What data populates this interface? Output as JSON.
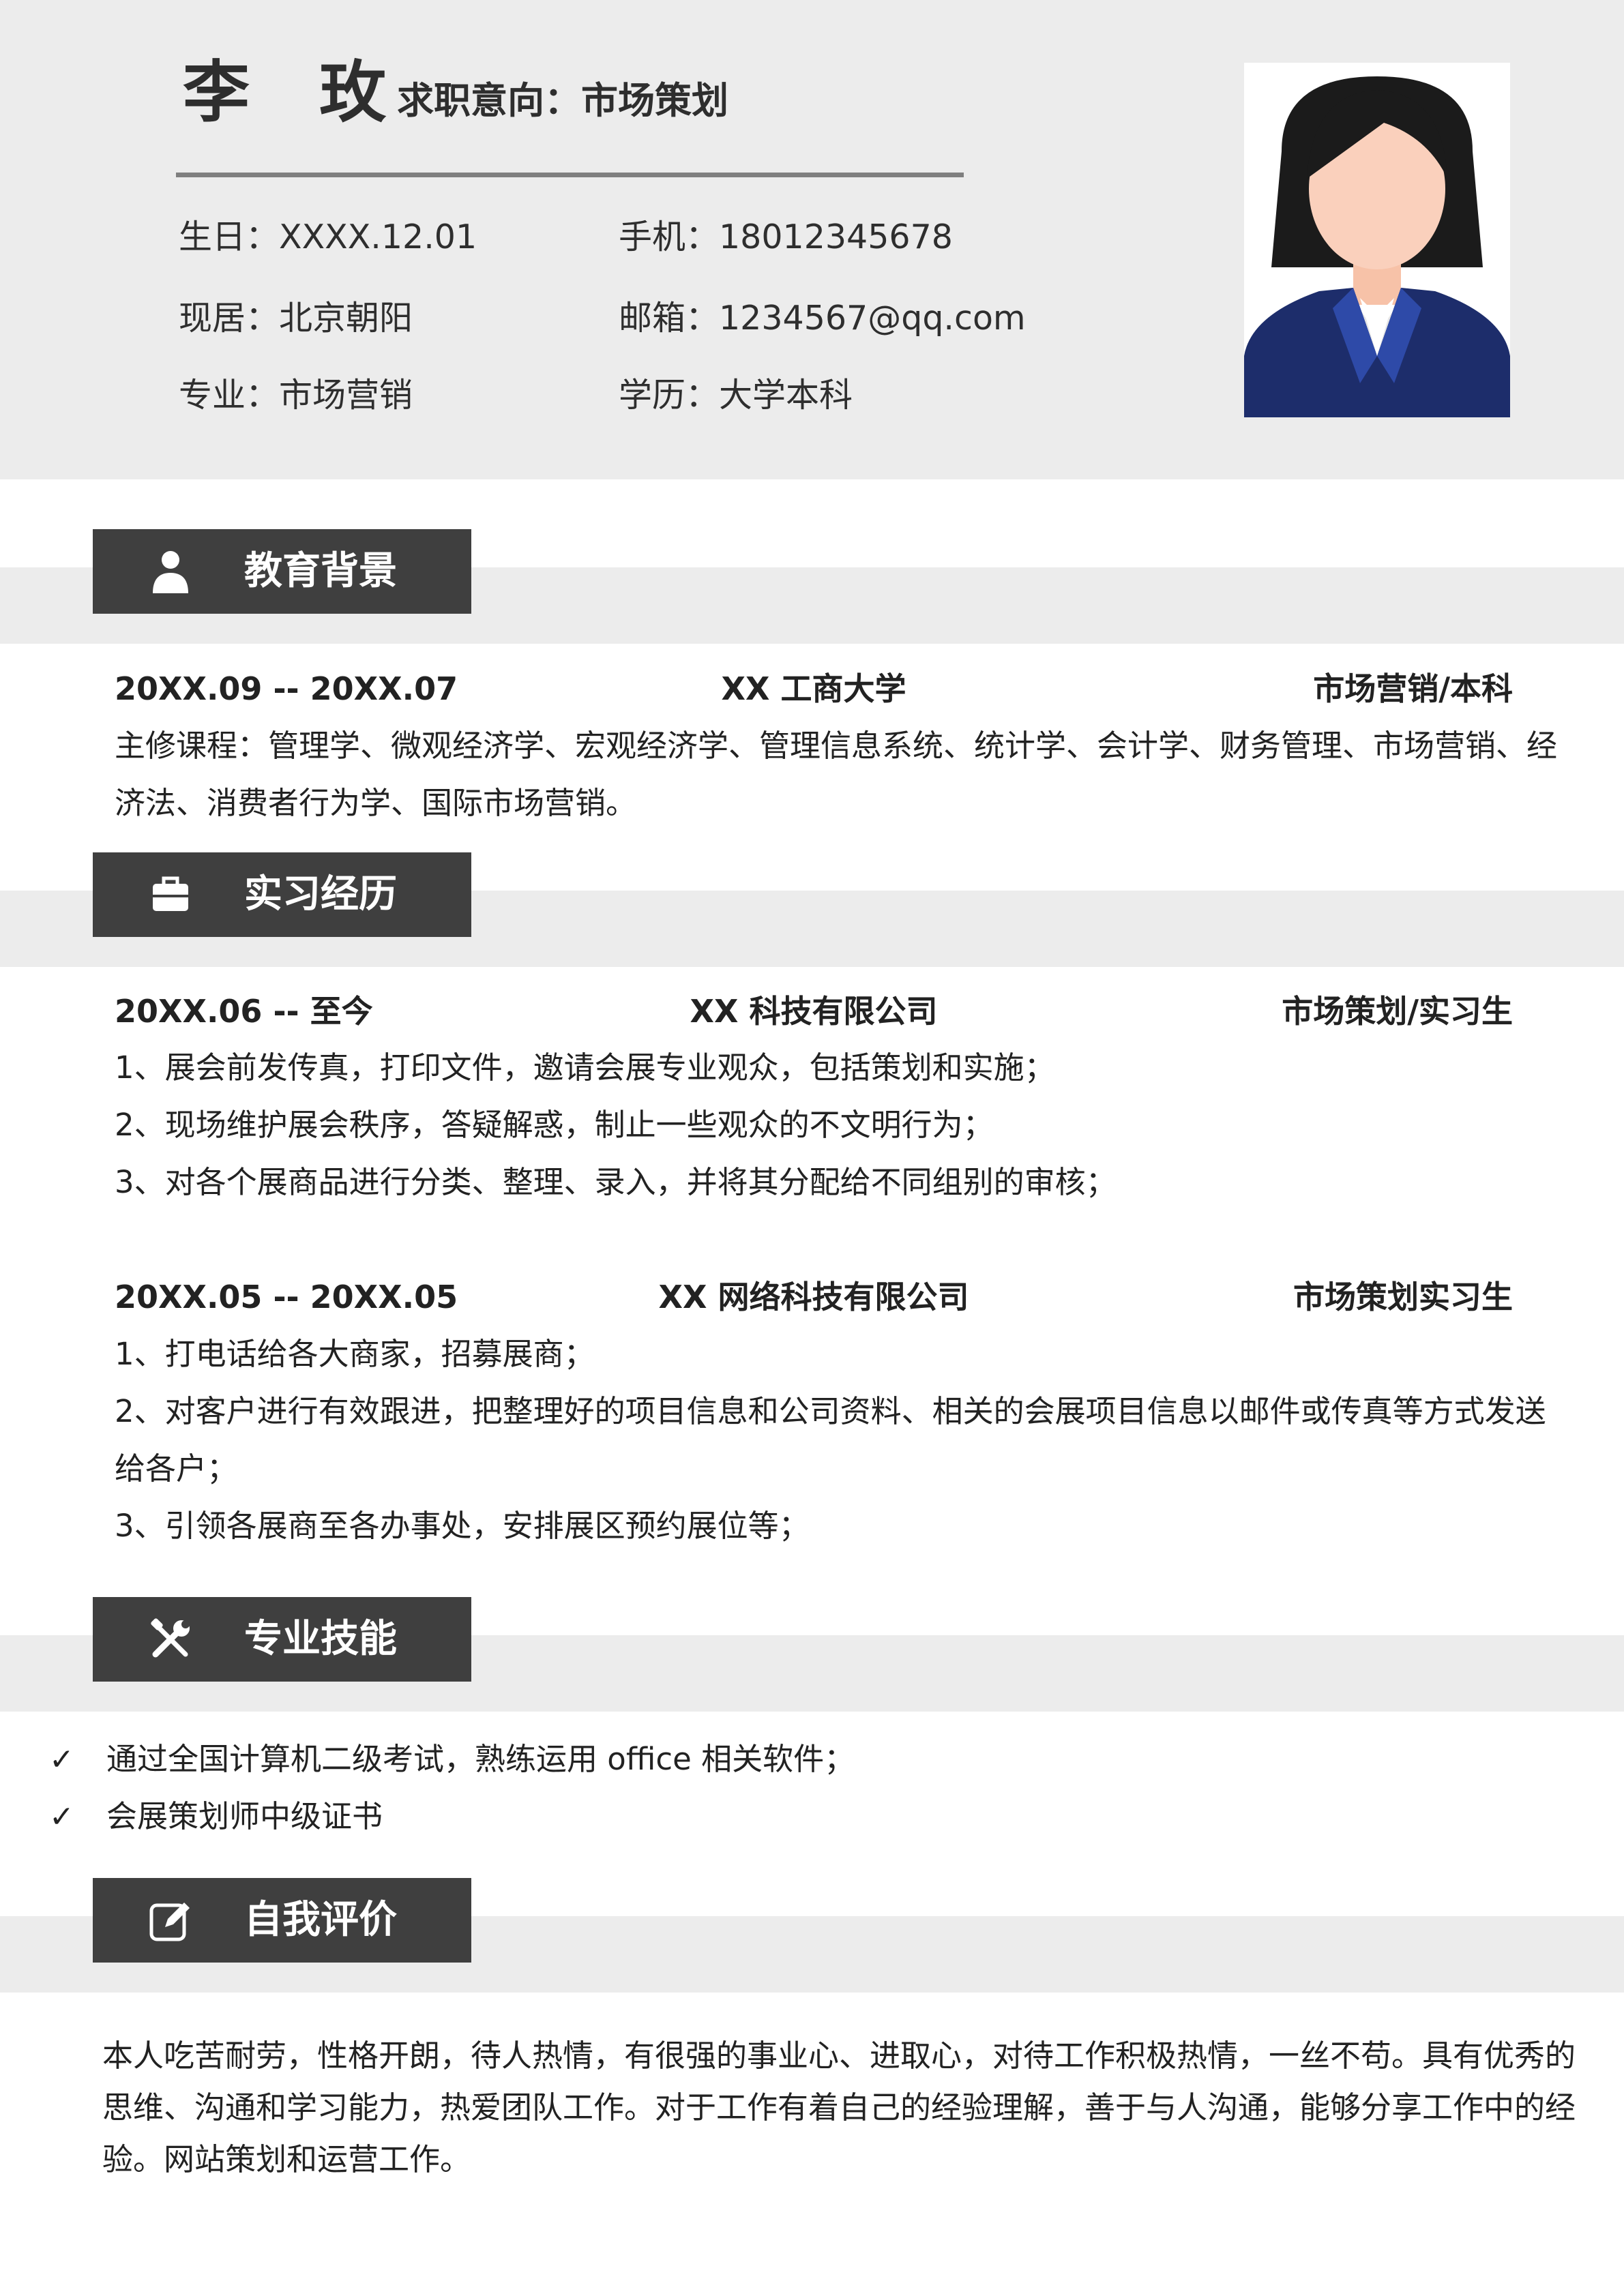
{
  "header": {
    "name": "李 玫",
    "intent": "求职意向：市场策划",
    "info": {
      "birthday": "生日：XXXX.12.01",
      "phone": "手机：18012345678",
      "location": "现居：北京朝阳",
      "email": "邮箱：1234567@qq.com",
      "major": "专业：市场营销",
      "education": "学历：大学本科"
    }
  },
  "sections": {
    "education": {
      "title": "教育背景",
      "icon": "person-icon"
    },
    "internship": {
      "title": "实习经历",
      "icon": "briefcase-icon"
    },
    "skills": {
      "title": "专业技能",
      "icon": "tools-icon"
    },
    "self": {
      "title": "自我评价",
      "icon": "edit-icon"
    }
  },
  "education": {
    "period": "20XX.09 -- 20XX.07",
    "school": "XX 工商大学",
    "degree": "市场营销/本科",
    "courses_line1": "主修课程：管理学、微观经济学、宏观经济学、管理信息系统、统计学、会计学、财务管理、市场营销、经",
    "courses_line2": "济法、消费者行为学、国际市场营销。"
  },
  "internships": [
    {
      "period": "20XX.06 --  至今",
      "company": "XX 科技有限公司",
      "role": "市场策划/实习生",
      "items": [
        "1、展会前发传真，打印文件，邀请会展专业观众，包括策划和实施；",
        "2、现场维护展会秩序，答疑解惑，制止一些观众的不文明行为；",
        "3、对各个展商品进行分类、整理、录入，并将其分配给不同组别的审核；"
      ]
    },
    {
      "period": "20XX.05 -- 20XX.05",
      "company": "XX 网络科技有限公司",
      "role": "市场策划实习生",
      "items": [
        "1、打电话给各大商家，招募展商；",
        "2、对客户进行有效跟进，把整理好的项目信息和公司资料、相关的会展项目信息以邮件或传真等方式发送",
        "给各户；",
        "3、引领各展商至各办事处，安排展区预约展位等；"
      ]
    }
  ],
  "skills": {
    "tick": "✓",
    "items": [
      "通过全国计算机二级考试，熟练运用 office 相关软件；",
      "会展策划师中级证书"
    ]
  },
  "self_evaluation": {
    "line1": "本人吃苦耐劳，性格开朗，待人热情，有很强的事业心、进取心，对待工作积极热情，一丝不苟。具有优秀的",
    "line2": "思维、沟通和学习能力，热爱团队工作。对于工作有着自己的经验理解，善于与人沟通，能够分享工作中的经",
    "line3": "验。网站策划和运营工作。"
  },
  "colors": {
    "header_bg": "#ececec",
    "section_tab": "#3f3f3f",
    "text": "#222222",
    "suit": "#1d2d6b"
  }
}
